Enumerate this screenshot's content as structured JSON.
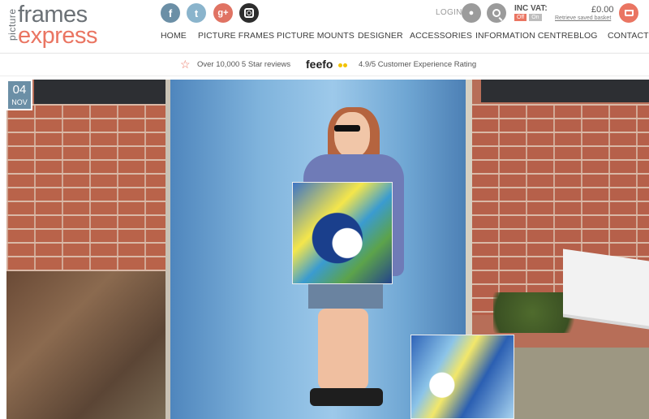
{
  "logo": {
    "picture": "picture",
    "frames": "frames",
    "express": "express"
  },
  "social": {
    "facebook": "f",
    "twitter": "t",
    "googleplus": "g+"
  },
  "account": {
    "login": "LOGIN"
  },
  "basket": {
    "vat_label": "INC VAT:",
    "vat_off": "Off",
    "vat_on": "On",
    "price": "£0.00",
    "retrieve": "Retrieve saved basket"
  },
  "nav": [
    "HOME",
    "PICTURE FRAMES",
    "PICTURE MOUNTS",
    "DESIGNER",
    "ACCESSORIES",
    "INFORMATION CENTRE",
    "BLOG",
    "CONTACT"
  ],
  "reviews": {
    "star_reviews": "Over 10,000 5 Star reviews",
    "feefo": "feefo",
    "rating": "4.9/5 Customer Experience Rating"
  },
  "post": {
    "day": "04",
    "month": "NOV"
  },
  "colors": {
    "accent": "#ea7562",
    "slate": "#6b8fa6",
    "text": "#3d3d3d"
  },
  "icons": [
    "facebook-icon",
    "twitter-icon",
    "googleplus-icon",
    "instagram-icon",
    "user-icon",
    "search-icon",
    "basket-icon",
    "star-icon"
  ]
}
